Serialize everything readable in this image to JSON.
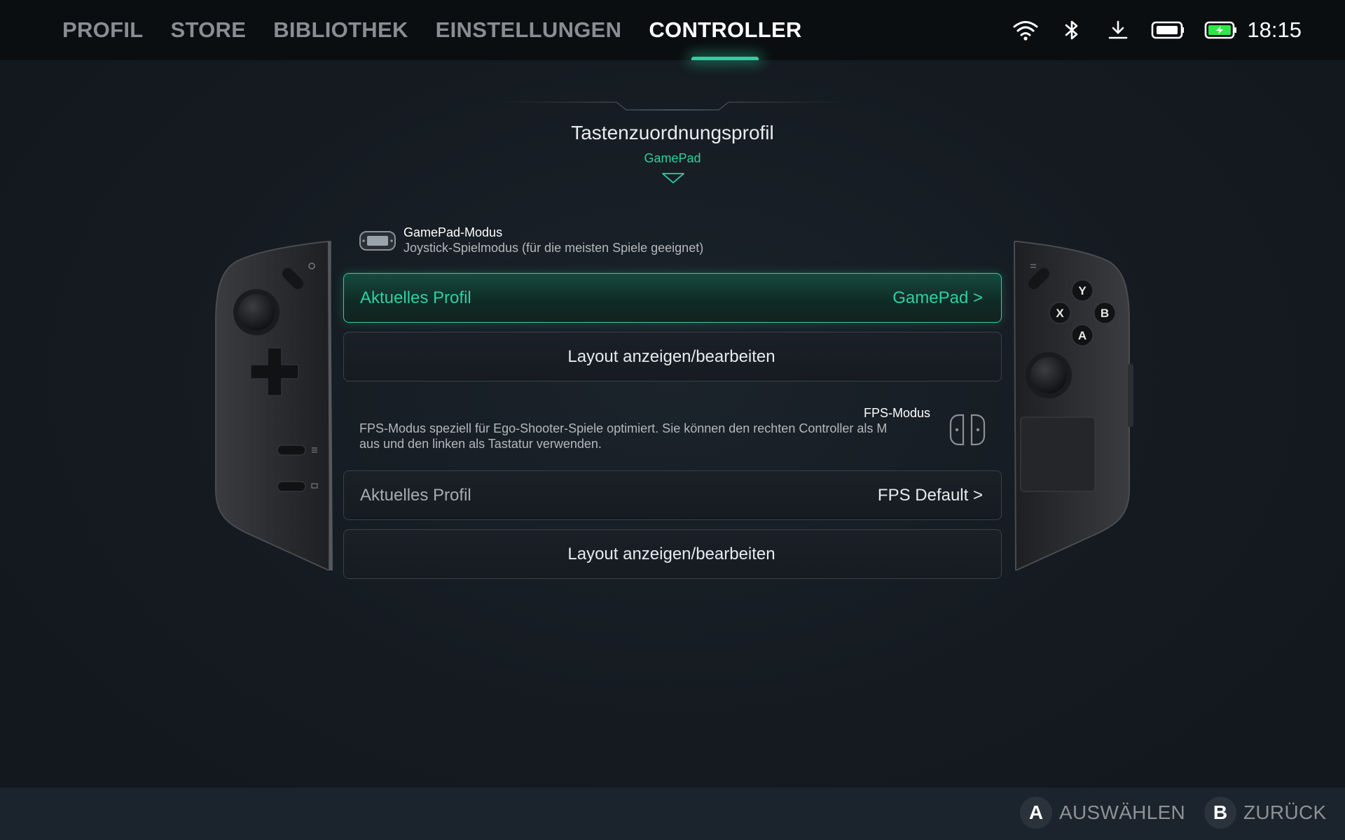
{
  "nav": {
    "items": [
      {
        "label": "PROFIL"
      },
      {
        "label": "STORE"
      },
      {
        "label": "BIBLIOTHEK"
      },
      {
        "label": "EINSTELLUNGEN"
      },
      {
        "label": "CONTROLLER",
        "active": true
      }
    ]
  },
  "status": {
    "icons": [
      "wifi-icon",
      "bluetooth-icon",
      "download-icon",
      "device-battery-icon",
      "battery-charging-icon"
    ],
    "time": "18:15"
  },
  "profile_header": {
    "title": "Tastenzuordnungsprofil",
    "subtitle": "GamePad"
  },
  "gamepad_mode": {
    "title": "GamePad-Modus",
    "description": "Joystick-Spielmodus (für die meisten Spiele geeignet)",
    "icon": "handheld-icon",
    "current_profile_label": "Aktuelles Profil",
    "current_profile_value": "GamePad >",
    "layout_label": "Layout anzeigen/bearbeiten"
  },
  "fps_mode": {
    "title": "FPS-Modus",
    "description_line1": "FPS-Modus speziell für Ego-Shooter-Spiele optimiert. Sie können den rechten Controller als M",
    "description_line2": "aus und den linken als Tastatur verwenden.",
    "icon": "split-controllers-icon",
    "current_profile_label": "Aktuelles Profil",
    "current_profile_value": "FPS Default >",
    "layout_label": "Layout anzeigen/bearbeiten"
  },
  "controller_right": {
    "buttons": [
      "Y",
      "X",
      "B",
      "A"
    ]
  },
  "bottom_hints": {
    "select_key": "A",
    "select_label": "AUSWÄHLEN",
    "back_key": "B",
    "back_label": "ZURÜCK"
  },
  "colors": {
    "accent": "#2fd0a0",
    "background": "#141a20",
    "topbar": "#0b0e11",
    "bottombar": "#1b232c"
  }
}
